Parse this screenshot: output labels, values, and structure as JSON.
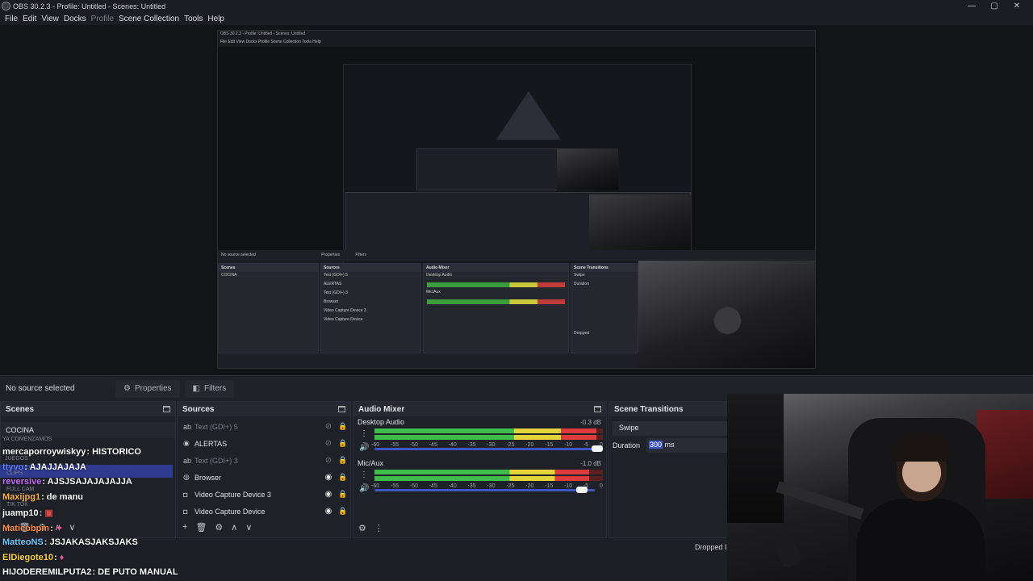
{
  "window": {
    "title": "OBS 30.2.3 - Profile: Untitled - Scenes: Untitled"
  },
  "menu": [
    "File",
    "Edit",
    "View",
    "Docks",
    "Profile",
    "Scene Collection",
    "Tools",
    "Help"
  ],
  "nested_preview": {
    "title": "OBS 30.2.3 - Profile: Untitled - Scenes: Untitled",
    "menu": "File  Edit  View  Docks  Profile  Scene Collection  Tools  Help",
    "status": "No source selected",
    "properties": "Properties",
    "filters": "Filters",
    "scenes_title": "Scenes",
    "sources_title": "Sources",
    "mixer_title": "Audio Mixer",
    "transitions_title": "Scene Transitions",
    "scene": "COCINA",
    "src": [
      "Text (GDI+) 5",
      "ALERTAS",
      "Text (GDI+) 3",
      "Browser",
      "Video Capture Device 3",
      "Video Capture Device"
    ],
    "desktop": "Desktop Audio",
    "mic": "Mic/Aux",
    "swipe": "Swipe",
    "duration": "Duration",
    "dropped": "Dropped"
  },
  "status": {
    "no_source": "No source selected",
    "properties": "Properties",
    "filters": "Filters"
  },
  "scenes": {
    "title": "Scenes",
    "items": [
      "COCINA"
    ]
  },
  "chat": {
    "messages": [
      {
        "user": "mercaporroywiskyy",
        "text": ": HISTORICO",
        "color": "#ffffff"
      },
      {
        "user": "ttyvo",
        "text": ": AJAJJAJAJA",
        "color": "#5f7dff"
      },
      {
        "user": "reversive",
        "text": ": AJSJSAJAJAJAJJA",
        "color": "#c86bff"
      },
      {
        "user": "Maxijpg1",
        "text": ": de manu",
        "color": "#ffb347"
      },
      {
        "user": "juamp10",
        "text": ":",
        "color": "#ffffff"
      },
      {
        "user": "Maticobpm",
        "text": ":",
        "color": "#ff8c42"
      },
      {
        "user": "MatteoNS",
        "text": ": JSJAKASJAKSJAKS",
        "color": "#6ec6ff"
      },
      {
        "user": "ElDiegote10",
        "text": ":",
        "color": "#ffd24a"
      },
      {
        "user": "HIJODEREMILPUTA2",
        "text": ": DE PUTO MANUAL",
        "color": "#ffffff"
      }
    ],
    "faint": [
      "YA COMENZAMOS",
      "JUEGOS",
      "FULL CAM",
      "TIK TOK",
      "CLIPS"
    ]
  },
  "sources": {
    "title": "Sources",
    "items": [
      {
        "name": "Text (GDI+) 5",
        "icon": "text-icon",
        "visible": false,
        "dim": true
      },
      {
        "name": "ALERTAS",
        "icon": "group-icon",
        "visible": false,
        "dim": false
      },
      {
        "name": "Text (GDI+) 3",
        "icon": "text-icon",
        "visible": false,
        "dim": true
      },
      {
        "name": "Browser",
        "icon": "globe-icon",
        "visible": true,
        "dim": false
      },
      {
        "name": "Video Capture Device 3",
        "icon": "camera-icon",
        "visible": true,
        "dim": false
      },
      {
        "name": "Video Capture Device",
        "icon": "camera-icon",
        "visible": true,
        "dim": false
      }
    ]
  },
  "mixer": {
    "title": "Audio Mixer",
    "scale": [
      "-60",
      "-55",
      "-50",
      "-45",
      "-40",
      "-35",
      "-30",
      "-25",
      "-20",
      "-15",
      "-10",
      "-5",
      "0"
    ],
    "channels": [
      {
        "name": "Desktop Audio",
        "db": "-0.3 dB",
        "level": 0.97,
        "volume": 1.0
      },
      {
        "name": "Mic/Aux",
        "db": "-1.0 dB",
        "level": 0.94,
        "volume": 0.93
      }
    ]
  },
  "transitions": {
    "title": "Scene Transitions",
    "type": "Swipe",
    "duration_label": "Duration",
    "duration_value": "300",
    "duration_unit": " ms"
  },
  "stats": {
    "dropped": "Dropped I"
  },
  "colors": {
    "accent": "#3e56c8",
    "meter_green": "#3ebd4c",
    "meter_yellow": "#e2d43a",
    "meter_red": "#de3c3c"
  }
}
